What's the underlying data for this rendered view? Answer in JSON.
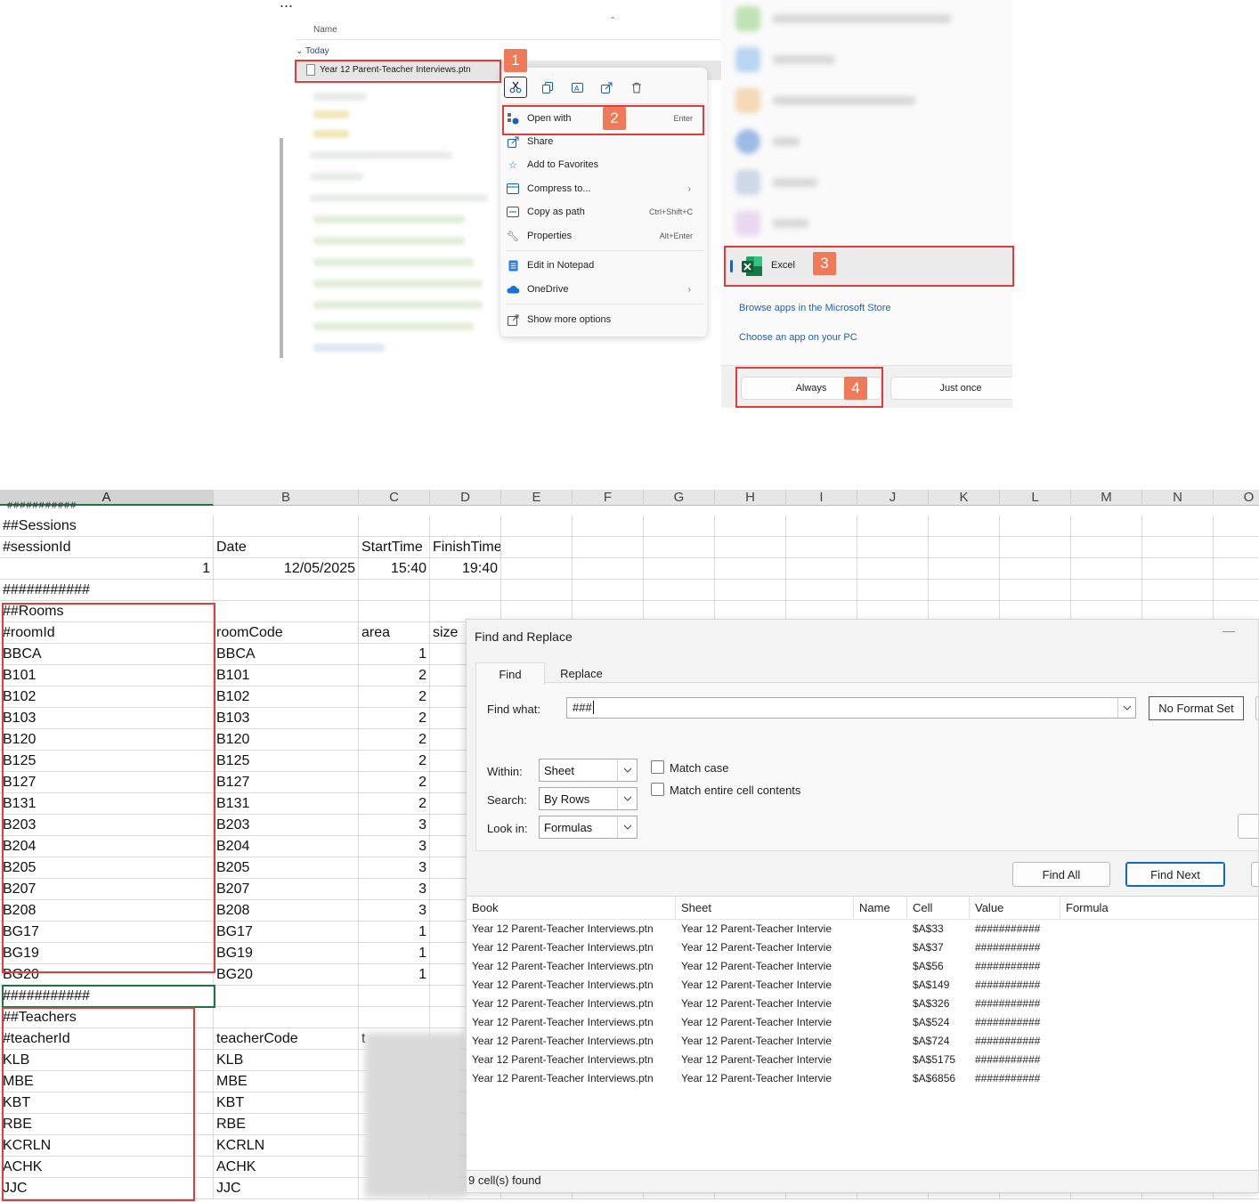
{
  "explorer": {
    "more": "...",
    "column_name": "Name",
    "group_today": "Today",
    "file_name": "Year 12 Parent-Teacher Interviews.ptn"
  },
  "context_menu": {
    "items": [
      {
        "label": "Open with",
        "shortcut": "Enter",
        "icon": "open-with-icon"
      },
      {
        "label": "Share",
        "shortcut": "",
        "icon": "share-icon"
      },
      {
        "label": "Add to Favorites",
        "shortcut": "",
        "icon": "star-icon"
      },
      {
        "label": "Compress to...",
        "shortcut": "",
        "icon": "zip-icon"
      },
      {
        "label": "Copy as path",
        "shortcut": "Ctrl+Shift+C",
        "icon": "path-icon"
      },
      {
        "label": "Properties",
        "shortcut": "Alt+Enter",
        "icon": "wrench-icon"
      },
      {
        "label": "Edit in Notepad",
        "shortcut": "",
        "icon": "notepad-icon"
      },
      {
        "label": "OneDrive",
        "shortcut": "",
        "icon": "cloud-icon"
      },
      {
        "label": "Show more options",
        "shortcut": "",
        "icon": "more-options-icon"
      }
    ]
  },
  "open_with": {
    "excel_label": "Excel",
    "browse_store": "Browse apps in the Microsoft Store",
    "choose_app": "Choose an app on your PC",
    "always": "Always",
    "just_once": "Just once"
  },
  "badges": [
    "1",
    "2",
    "3",
    "4"
  ],
  "sheet": {
    "columns": [
      "A",
      "B",
      "C",
      "D",
      "E",
      "F",
      "G",
      "H",
      "I",
      "J",
      "K",
      "L",
      "M",
      "N",
      "O"
    ],
    "rows": [
      [
        "##Sessions",
        "",
        "",
        ""
      ],
      [
        "#sessionId",
        "Date",
        "StartTime",
        "FinishTime"
      ],
      [
        "1",
        "12/05/2025",
        "15:40",
        "19:40"
      ],
      [
        "###########",
        "",
        "",
        ""
      ],
      [
        "##Rooms",
        "",
        "",
        ""
      ],
      [
        "#roomId",
        "roomCode",
        "area",
        "size"
      ],
      [
        "BBCA",
        "BBCA",
        "1",
        ""
      ],
      [
        "B101",
        "B101",
        "2",
        ""
      ],
      [
        "B102",
        "B102",
        "2",
        ""
      ],
      [
        "B103",
        "B103",
        "2",
        ""
      ],
      [
        "B120",
        "B120",
        "2",
        ""
      ],
      [
        "B125",
        "B125",
        "2",
        ""
      ],
      [
        "B127",
        "B127",
        "2",
        ""
      ],
      [
        "B131",
        "B131",
        "2",
        ""
      ],
      [
        "B203",
        "B203",
        "3",
        ""
      ],
      [
        "B204",
        "B204",
        "3",
        ""
      ],
      [
        "B205",
        "B205",
        "3",
        ""
      ],
      [
        "B207",
        "B207",
        "3",
        ""
      ],
      [
        "B208",
        "B208",
        "3",
        ""
      ],
      [
        "BG17",
        "BG17",
        "1",
        ""
      ],
      [
        "BG19",
        "BG19",
        "1",
        ""
      ],
      [
        "BG20",
        "BG20",
        "1",
        ""
      ],
      [
        "###########",
        "",
        "",
        ""
      ],
      [
        "##Teachers",
        "",
        "",
        ""
      ],
      [
        "#teacherId",
        "teacherCode",
        "t",
        ""
      ],
      [
        "KLB",
        "KLB",
        "",
        ""
      ],
      [
        "MBE",
        "MBE",
        "",
        ""
      ],
      [
        "KBT",
        "KBT",
        "",
        ""
      ],
      [
        "RBE",
        "RBE",
        "",
        ""
      ],
      [
        "KCRLN",
        "KCRLN",
        "",
        ""
      ],
      [
        "ACHK",
        "ACHK",
        "",
        ""
      ],
      [
        "JJC",
        "JJC",
        "",
        ""
      ]
    ]
  },
  "find_replace": {
    "title": "Find and Replace",
    "minimize": "—",
    "tab_find": "Find",
    "tab_replace": "Replace",
    "find_what_label": "Find what:",
    "find_what_value": "###",
    "no_format": "No Format Set",
    "within_label": "Within:",
    "within_value": "Sheet",
    "search_label": "Search:",
    "search_value": "By Rows",
    "lookin_label": "Look in:",
    "lookin_value": "Formulas",
    "match_case": "Match case",
    "match_entire": "Match entire cell contents",
    "find_all": "Find All",
    "find_next": "Find Next",
    "result_headers": [
      "Book",
      "Sheet",
      "Name",
      "Cell",
      "Value",
      "Formula"
    ],
    "results": [
      [
        "Year 12 Parent-Teacher Interviews.ptn",
        "Year 12 Parent-Teacher Intervie",
        "",
        "$A$33",
        "###########",
        ""
      ],
      [
        "Year 12 Parent-Teacher Interviews.ptn",
        "Year 12 Parent-Teacher Intervie",
        "",
        "$A$37",
        "###########",
        ""
      ],
      [
        "Year 12 Parent-Teacher Interviews.ptn",
        "Year 12 Parent-Teacher Intervie",
        "",
        "$A$56",
        "###########",
        ""
      ],
      [
        "Year 12 Parent-Teacher Interviews.ptn",
        "Year 12 Parent-Teacher Intervie",
        "",
        "$A$149",
        "###########",
        ""
      ],
      [
        "Year 12 Parent-Teacher Interviews.ptn",
        "Year 12 Parent-Teacher Intervie",
        "",
        "$A$326",
        "###########",
        ""
      ],
      [
        "Year 12 Parent-Teacher Interviews.ptn",
        "Year 12 Parent-Teacher Intervie",
        "",
        "$A$524",
        "###########",
        ""
      ],
      [
        "Year 12 Parent-Teacher Interviews.ptn",
        "Year 12 Parent-Teacher Intervie",
        "",
        "$A$724",
        "###########",
        ""
      ],
      [
        "Year 12 Parent-Teacher Interviews.ptn",
        "Year 12 Parent-Teacher Intervie",
        "",
        "$A$5175",
        "###########",
        ""
      ],
      [
        "Year 12 Parent-Teacher Interviews.ptn",
        "Year 12 Parent-Teacher Intervie",
        "",
        "$A$6856",
        "###########",
        ""
      ]
    ],
    "status": "9 cell(s) found"
  },
  "colors": {
    "annotation_red": "#e23b3b",
    "badge_orange": "#ee7a5a",
    "excel_green": "#217346",
    "link_blue": "#1f5fb3"
  }
}
